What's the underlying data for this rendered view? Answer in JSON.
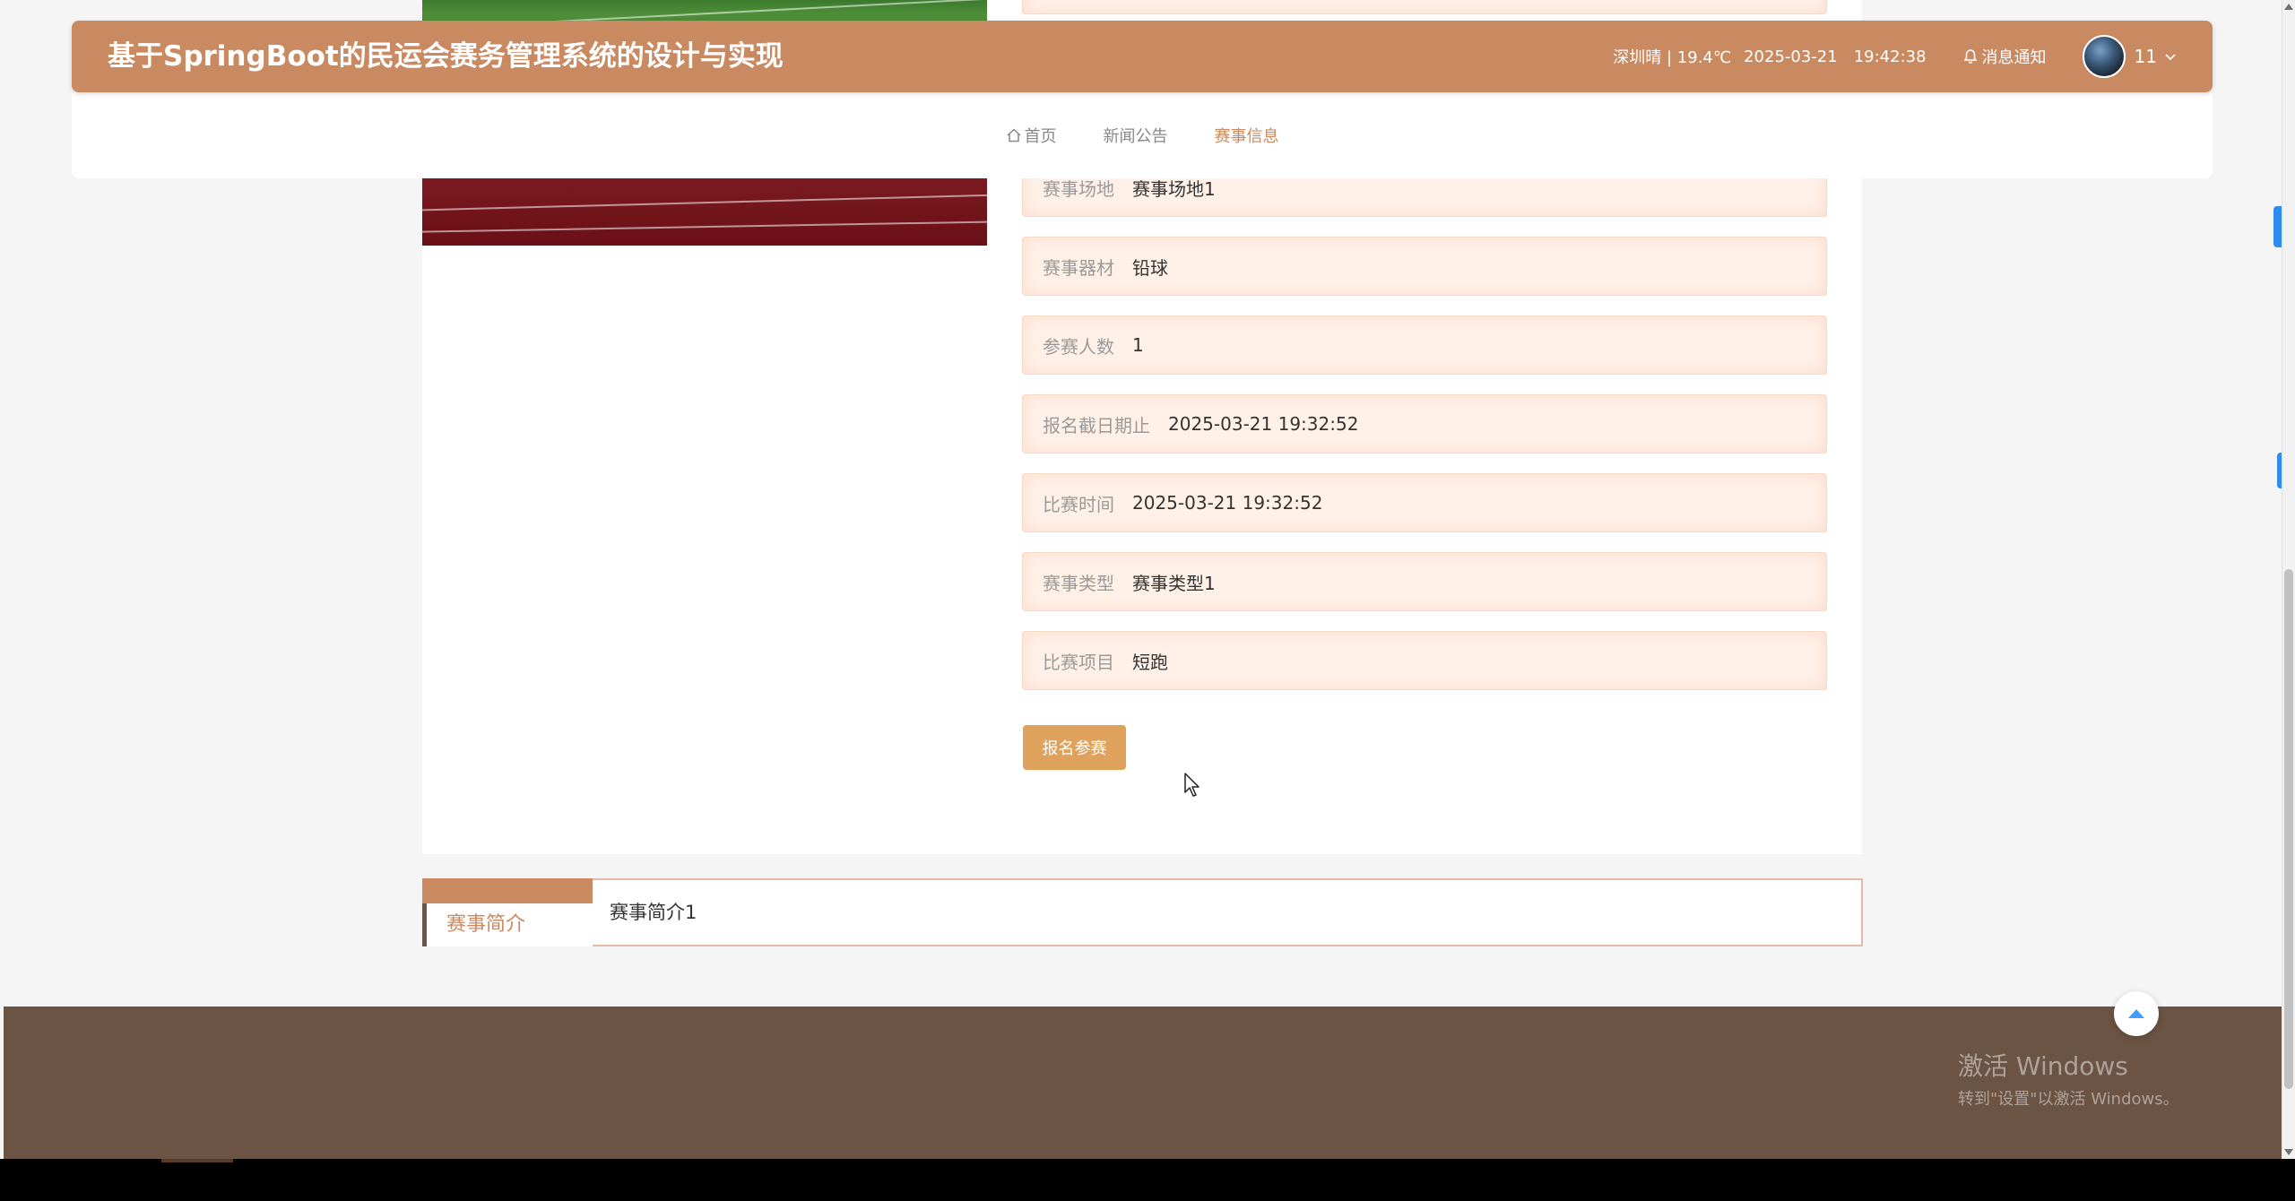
{
  "header": {
    "title": "基于SpringBoot的民运会赛务管理系统的设计与实现",
    "weather": "深圳晴 | 19.4℃",
    "date": "2025-03-21",
    "time": "19:42:38",
    "notice": "消息通知",
    "username": "11"
  },
  "nav": {
    "items": [
      "首页",
      "新闻公告",
      "赛事信息"
    ],
    "active": "赛事信息"
  },
  "details": [
    {
      "label": "赛事场地",
      "value": "赛事场地1"
    },
    {
      "label": "赛事器材",
      "value": "铅球"
    },
    {
      "label": "参赛人数",
      "value": "1"
    },
    {
      "label": "报名截日期止",
      "value": "2025-03-21 19:32:52"
    },
    {
      "label": "比赛时间",
      "value": "2025-03-21 19:32:52"
    },
    {
      "label": "赛事类型",
      "value": "赛事类型1"
    },
    {
      "label": "比赛项目",
      "value": "短跑"
    }
  ],
  "signup_button": "报名参赛",
  "intro": {
    "tab": "赛事简介",
    "content": "赛事简介1"
  },
  "watermark": {
    "title": "激活 Windows",
    "subtitle": "转到\"设置\"以激活 Windows。"
  },
  "colors": {
    "accent": "#c98a62",
    "button": "#dfa25c",
    "footer": "#6c5444"
  }
}
